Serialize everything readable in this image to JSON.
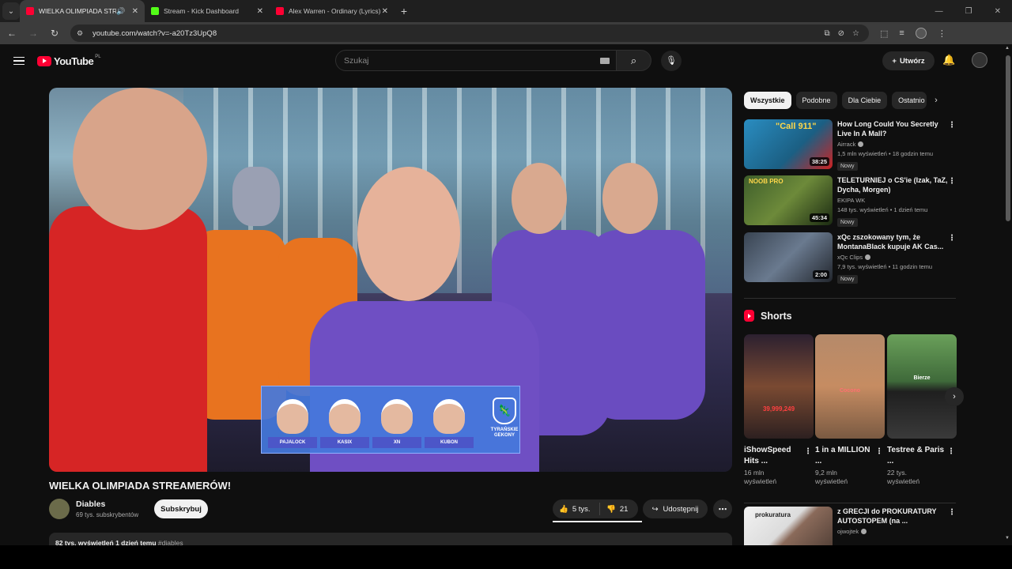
{
  "browser": {
    "tabs": [
      {
        "title": "WIELKA OLIMPIADA STREAMERÓW!",
        "icon": "youtube-favicon",
        "active": true,
        "audio": true
      },
      {
        "title": "Stream - Kick Dashboard",
        "icon": "kick-favicon",
        "active": false
      },
      {
        "title": "Alex Warren - Ordinary (Lyrics)",
        "icon": "youtube-favicon",
        "active": false
      }
    ],
    "url": "youtube.com/watch?v=-a20Tz3UpQ8"
  },
  "header": {
    "logo": "YouTube",
    "country": "PL",
    "search_placeholder": "Szukaj",
    "create_label": "Utwórz"
  },
  "video": {
    "title": "WIELKA OLIMPIADA STREAMERÓW!",
    "overlay": {
      "players": [
        "PAJALOCK",
        "KASIX",
        "XN",
        "KUBON"
      ],
      "team": "TYRAŃSKIE GEKONY"
    },
    "channel": "Diables",
    "subscribers": "69 tys. subskrybentów",
    "subscribe_label": "Subskrybuj",
    "likes": "5 tys.",
    "dislikes": "21",
    "share_label": "Udostępnij",
    "description_meta": "82 tys. wyświetleń  1 dzień temu",
    "description_tags": "#diables"
  },
  "sidebar": {
    "chips": [
      "Wszystkie",
      "Podobne",
      "Dla Ciebie",
      "Ostatnio"
    ],
    "recommendations": [
      {
        "title": "How Long Could You Secretly Live In A Mall?",
        "channel": "Airrack",
        "verified": true,
        "meta": "1,5 mln wyświetleń • 18 godzin temu",
        "badge": "Nowy",
        "duration": "38:25",
        "thumb_text": "\"Call 911\""
      },
      {
        "title": "TELETURNIEJ o CS'ie (Izak, TaZ, Dycha, Morgen)",
        "channel": "EKIPA WK",
        "verified": false,
        "meta": "148 tys. wyświetleń • 1 dzień temu",
        "badge": "Nowy",
        "duration": "45:34",
        "thumb_text": "NOOB  PRO"
      },
      {
        "title": "xQc zszokowany tym, że MontanaBlack kupuje AK Cas...",
        "channel": "xQc Clips",
        "verified": true,
        "meta": "7,9 tys. wyświetleń • 11 godzin temu",
        "badge": "Nowy",
        "duration": "2:00",
        "thumb_text": ""
      }
    ],
    "shorts_title": "Shorts",
    "shorts": [
      {
        "title": "iShowSpeed Hits ...",
        "views": "16 mln wyświetleń",
        "thumb_text": "39,999,249"
      },
      {
        "title": "1 in a MILLION ...",
        "views": "9,2 mln wyświetleń",
        "thumb_text": "Cocono"
      },
      {
        "title": "Testree & Paris ...",
        "views": "22 tys. wyświetleń",
        "thumb_text": "Bierze"
      }
    ],
    "rec4": {
      "title": "z GRECJI do PROKURATURY AUTOSTOPEM (na ...",
      "channel": "ojwojtek",
      "verified": true,
      "thumb_text": "prokuratura"
    }
  },
  "colors": {
    "accent": "#ff0033",
    "background": "#0f0f0f",
    "surface": "#272727"
  }
}
